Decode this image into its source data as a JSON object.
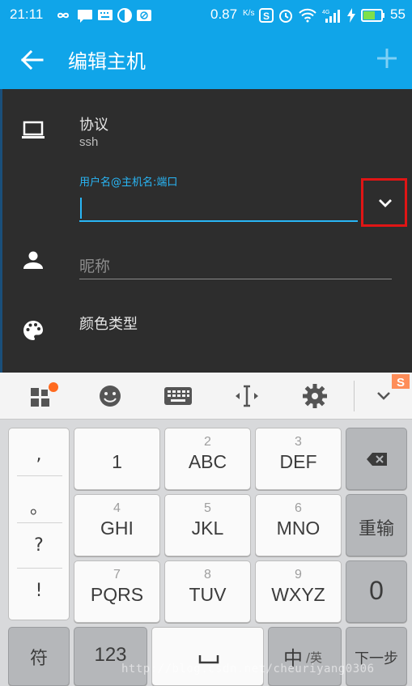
{
  "status_bar": {
    "time": "21:11",
    "speed": "0.87",
    "speed_unit": "K/s",
    "battery": "55"
  },
  "toolbar": {
    "title": "编辑主机"
  },
  "form": {
    "protocol_label": "协议",
    "protocol_value": "ssh",
    "host_hint": "用户名@主机名:端口",
    "host_value": "",
    "nickname_placeholder": "昵称",
    "color_label": "颜色类型"
  },
  "keyboard": {
    "punctuation": [
      ",",
      "。",
      "?",
      "!"
    ],
    "keys": [
      {
        "num": "",
        "letters": "1"
      },
      {
        "num": "2",
        "letters": "ABC"
      },
      {
        "num": "3",
        "letters": "DEF"
      },
      {
        "num": "4",
        "letters": "GHI"
      },
      {
        "num": "5",
        "letters": "JKL"
      },
      {
        "num": "6",
        "letters": "MNO"
      },
      {
        "num": "7",
        "letters": "PQRS"
      },
      {
        "num": "8",
        "letters": "TUV"
      },
      {
        "num": "9",
        "letters": "WXYZ"
      }
    ],
    "retype_label": "重输",
    "zero_label": "0",
    "symbol_label": "符",
    "numeric_label": "123",
    "lang_main": "中",
    "lang_sub": "/英",
    "next_label": "下一步"
  },
  "watermark": "http://blog.csdn.net/cheuriyang0306",
  "colors": {
    "accent": "#10a5e9",
    "focus": "#29b6f6",
    "highlight_box": "#e01515",
    "background": "#2d2d2d"
  }
}
